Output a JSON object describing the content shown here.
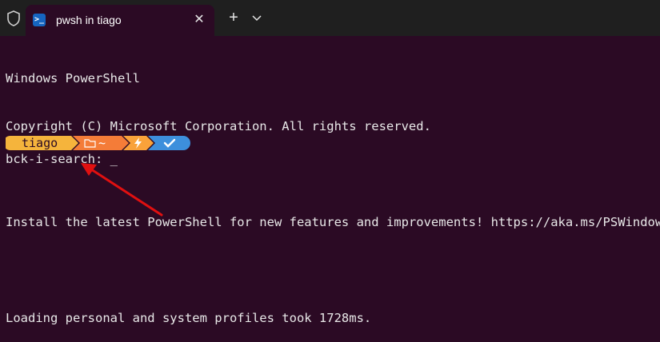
{
  "tab": {
    "title": "pwsh in tiago",
    "icon": "powershell-icon",
    "close": "✕"
  },
  "toolbar": {
    "new_tab": "+",
    "dropdown": "chevron-down-icon"
  },
  "terminal": {
    "lines": [
      "Windows PowerShell",
      "Copyright (C) Microsoft Corporation. All rights reserved.",
      "",
      "Install the latest PowerShell for new features and improvements! https://aka.ms/PSWindows",
      "",
      "Loading personal and system profiles took 1728ms."
    ],
    "search_prompt": "bck-i-search: ",
    "cursor": "_"
  },
  "prompt": {
    "user": "tiago",
    "path": "~",
    "colors": {
      "user_segment": "#f5b43c",
      "path_segment": "#f47c38",
      "power_segment": "#f9a23a",
      "status_segment": "#3d8fdc"
    }
  },
  "colors": {
    "background": "#2b0a24",
    "tabbar": "#1f1f1f",
    "text": "#e8e8e8",
    "annotation_arrow": "#e01010"
  }
}
